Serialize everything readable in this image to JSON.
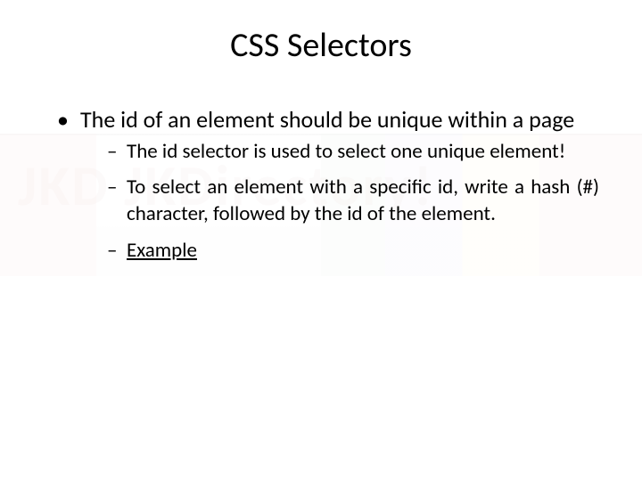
{
  "title": "CSS Selectors",
  "bullets": [
    {
      "text": "The id of an element should be unique within a page",
      "sub": [
        "The id selector is used to select one unique element!",
        "To select an element with a specific id, write a hash (#) character, followed by the id of the element.",
        "Example"
      ]
    }
  ],
  "watermark": {
    "brand": "JKDirectory",
    "tagline": "INTU B Tech CSE"
  }
}
